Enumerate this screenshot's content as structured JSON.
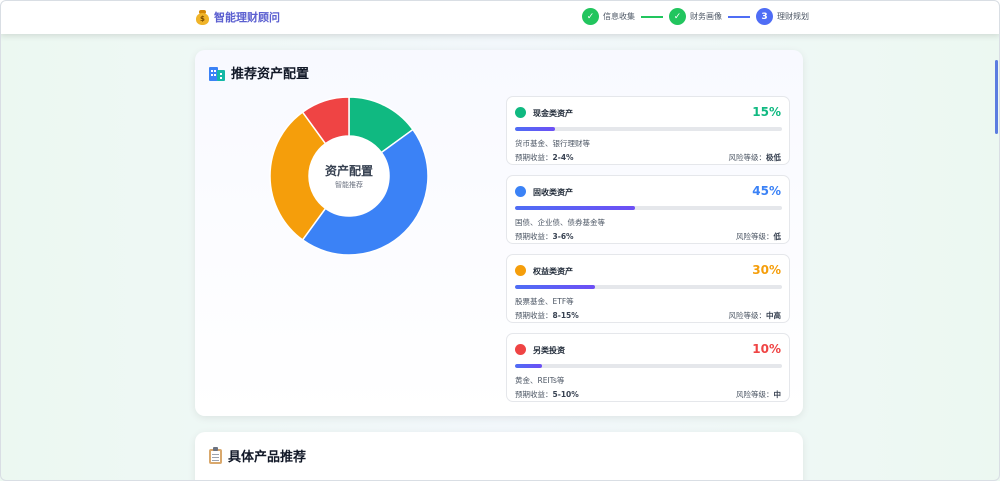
{
  "header": {
    "app_title": "智能理财顾问",
    "steps": [
      {
        "label": "信息收集",
        "mark": "✓",
        "state": "done"
      },
      {
        "label": "财务画像",
        "mark": "✓",
        "state": "done"
      },
      {
        "label": "理财规划",
        "mark": "3",
        "state": "active"
      }
    ]
  },
  "allocation": {
    "title": "推荐资产配置",
    "center_title": "资产配置",
    "center_subtitle": "智能推荐",
    "items": [
      {
        "name": "现金类资产",
        "percent": 15,
        "percent_label": "15%",
        "color": "#10b981",
        "desc": "货币基金、银行理财等",
        "return_label": "预期收益：",
        "return_value": "2-4%",
        "risk_label": "风险等级：",
        "risk_value": "极低"
      },
      {
        "name": "固收类资产",
        "percent": 45,
        "percent_label": "45%",
        "color": "#3b82f6",
        "desc": "国债、企业债、债券基金等",
        "return_label": "预期收益：",
        "return_value": "3-6%",
        "risk_label": "风险等级：",
        "risk_value": "低"
      },
      {
        "name": "权益类资产",
        "percent": 30,
        "percent_label": "30%",
        "color": "#f59e0b",
        "desc": "股票基金、ETF等",
        "return_label": "预期收益：",
        "return_value": "8-15%",
        "risk_label": "风险等级：",
        "risk_value": "中高"
      },
      {
        "name": "另类投资",
        "percent": 10,
        "percent_label": "10%",
        "color": "#ef4444",
        "desc": "黄金、REITs等",
        "return_label": "预期收益：",
        "return_value": "5-10%",
        "risk_label": "风险等级：",
        "risk_value": "中"
      }
    ]
  },
  "products": {
    "title": "具体产品推荐"
  }
}
